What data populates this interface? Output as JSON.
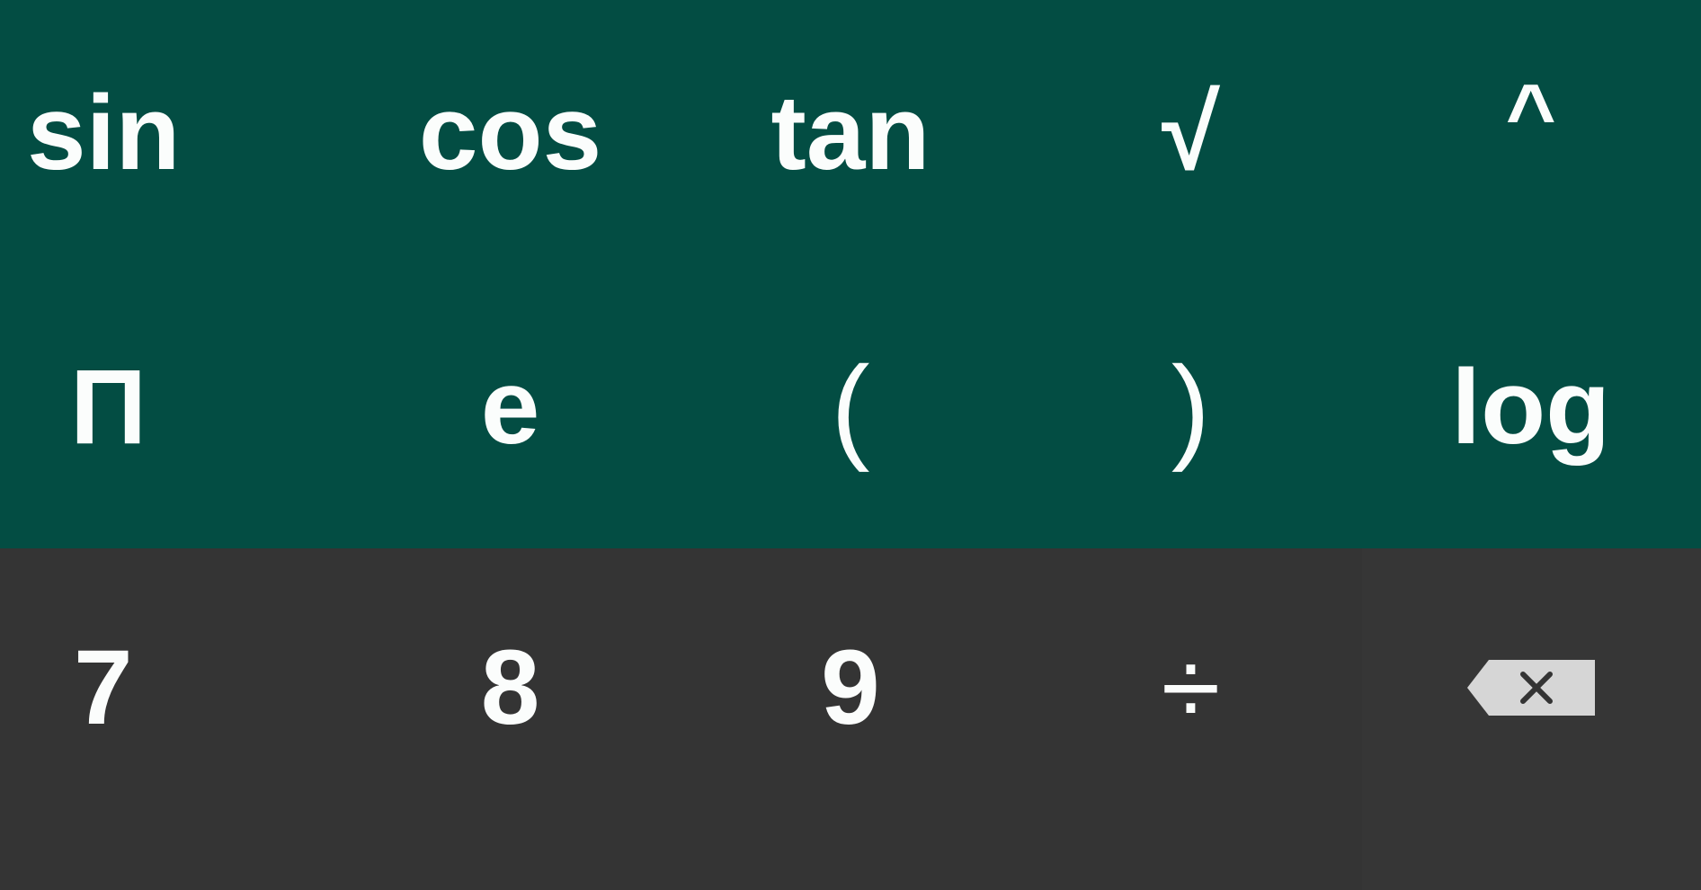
{
  "keypad": {
    "scientific_row_1": [
      "sin",
      "cos",
      "tan",
      "√",
      "^"
    ],
    "scientific_row_2": [
      "Π",
      "e",
      "(",
      ")",
      "log"
    ],
    "numeric_row_1": [
      "7",
      "8",
      "9",
      "÷"
    ],
    "backspace_icon": "backspace-icon"
  },
  "colors": {
    "scientific_panel_bg": "#034d43",
    "numeric_panel_bg": "#343434",
    "key_text": "#fbfdfc",
    "backspace_icon_fill": "#d6d6d6"
  }
}
